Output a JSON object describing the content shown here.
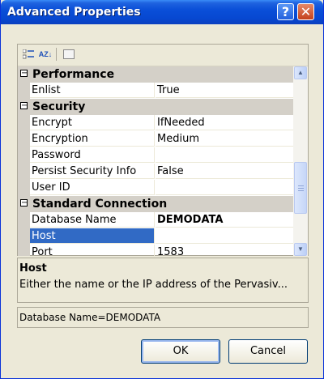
{
  "window": {
    "title": "Advanced Properties",
    "help_glyph": "?",
    "close_glyph": "✕"
  },
  "toolbar": {
    "categorized_icon": "categorized-icon",
    "alphabetical_label": "AZ↓",
    "property_pages_icon": "property-pages-icon"
  },
  "grid": {
    "categories": [
      {
        "name": "Performance",
        "expanded": true
      },
      {
        "name": "Security",
        "expanded": true
      },
      {
        "name": "Standard Connection",
        "expanded": true
      }
    ],
    "properties": [
      {
        "name": "Enlist",
        "value": "True"
      },
      {
        "name": "Encrypt",
        "value": "IfNeeded"
      },
      {
        "name": "Encryption",
        "value": "Medium"
      },
      {
        "name": "Password",
        "value": ""
      },
      {
        "name": "Persist Security Info",
        "value": "False"
      },
      {
        "name": "User ID",
        "value": ""
      },
      {
        "name": "Database Name",
        "value": "DEMODATA"
      },
      {
        "name": "Host",
        "value": ""
      },
      {
        "name": "Port",
        "value": "1583"
      }
    ],
    "selected": "Host",
    "expander_glyph": "−"
  },
  "help": {
    "title": "Host",
    "description": "Either the name or the IP address of the Pervasiv..."
  },
  "status": {
    "text": "Database Name=DEMODATA"
  },
  "buttons": {
    "ok": "OK",
    "cancel": "Cancel"
  },
  "colors": {
    "titlebar": "#0a4fd8",
    "selection": "#316ac5",
    "dialog_bg": "#ece9d8",
    "category_bg": "#d4d0c8"
  }
}
